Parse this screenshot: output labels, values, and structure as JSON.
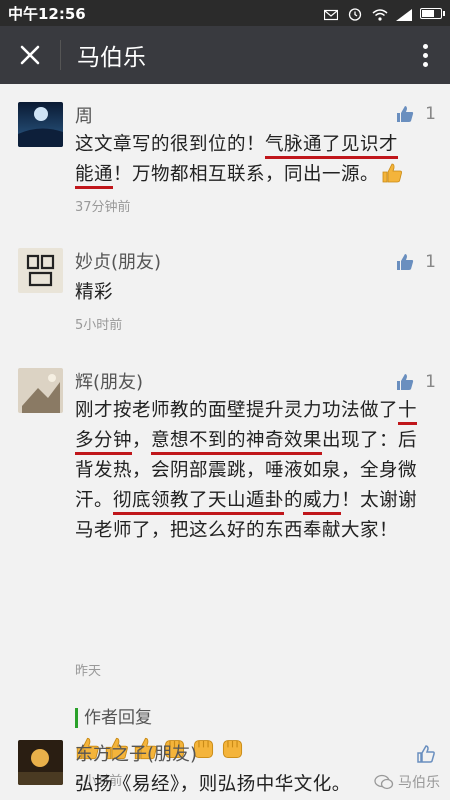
{
  "status_bar": {
    "time": "中午12:56"
  },
  "app_bar": {
    "title": "马伯乐"
  },
  "comments": [
    {
      "name": "周",
      "likes": "1",
      "text_parts": [
        "这文章写的很到位的！",
        "气脉通了见识才",
        "能通",
        "！万物都相互联系，同出一源。"
      ],
      "time": "37分钟前"
    },
    {
      "name": "妙贞(朋友)",
      "likes": "1",
      "text": "精彩",
      "time": "5小时前"
    },
    {
      "name": "辉(朋友)",
      "likes": "1",
      "text_parts": [
        "刚才按老师教的面壁提升灵力功法做了",
        "十多分钟",
        "，",
        "意想不到的神奇效果",
        "出现了：后背发热，会阴部震跳，唾液如泉，全身微汗。",
        "彻底领教了天山遁卦",
        "的",
        "威力",
        "！太谢谢马老师了，把这么好的东西奉献大家！"
      ],
      "time": "昨天",
      "reply": {
        "title": "作者回复",
        "time": "2小时前"
      }
    },
    {
      "name": "东方之子(朋友)",
      "likes": "",
      "text": "弘扬《易经》，则弘扬中华文化。"
    }
  ],
  "watermark": "马伯乐"
}
